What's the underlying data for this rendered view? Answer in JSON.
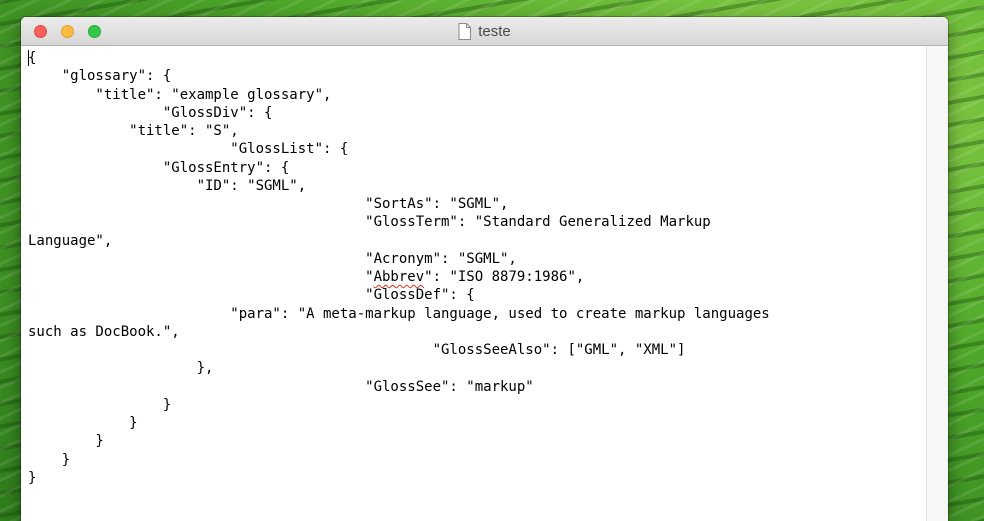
{
  "window": {
    "title": "teste",
    "document_icon": "document-icon",
    "buttons": {
      "close": "close-button",
      "minimize": "minimize-button",
      "zoom": "zoom-button"
    }
  },
  "editor": {
    "lines": [
      "{",
      "    \"glossary\": {",
      "        \"title\": \"example glossary\",",
      "                \"GlossDiv\": {",
      "            \"title\": \"S\",",
      "                        \"GlossList\": {",
      "                \"GlossEntry\": {",
      "                    \"ID\": \"SGML\",",
      "                                        \"SortAs\": \"SGML\",",
      "                                        \"GlossTerm\": \"Standard Generalized Markup",
      "Language\",",
      "                                        \"Acronym\": \"SGML\",",
      "                                        \"Abbrev\": \"ISO 8879:1986\",",
      "                                        \"GlossDef\": {",
      "                        \"para\": \"A meta-markup language, used to create markup languages",
      "such as DocBook.\",",
      "                                                \"GlossSeeAlso\": [\"GML\", \"XML\"]",
      "                    },",
      "                                        \"GlossSee\": \"markup\"",
      "                }",
      "            }",
      "        }",
      "    }",
      "}"
    ],
    "misspelled_word": "Abbrev"
  },
  "colors": {
    "close": "#fc605c",
    "minimize": "#fdbc40",
    "zoom": "#34c84a",
    "spellcheck_underline": "#e0301e"
  }
}
